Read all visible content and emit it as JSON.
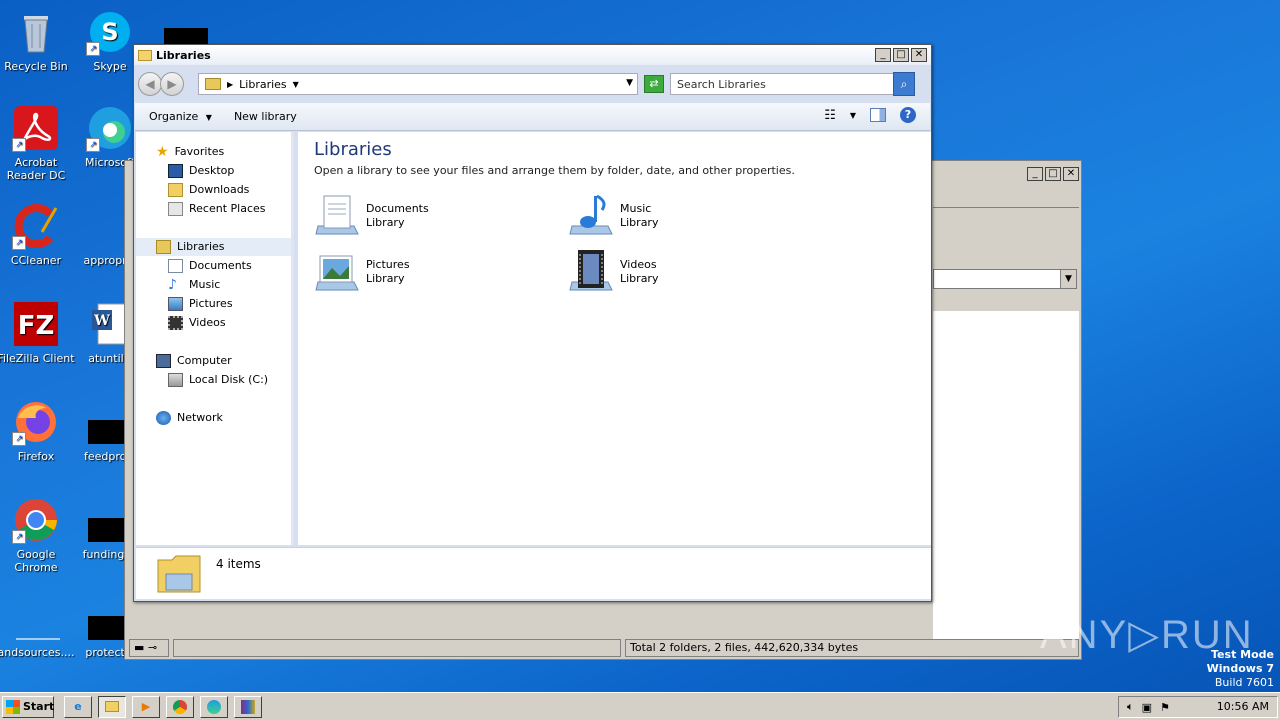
{
  "desktop": {
    "icons": [
      {
        "label": "Recycle Bin"
      },
      {
        "label": "Skype"
      },
      {
        "label": "Acrobat Reader DC"
      },
      {
        "label": "Microsoft"
      },
      {
        "label": "CCleaner"
      },
      {
        "label": "appropria"
      },
      {
        "label": "FileZilla Client"
      },
      {
        "label": "atuntil.r"
      },
      {
        "label": "Firefox"
      },
      {
        "label": "feedprovi"
      },
      {
        "label": "Google Chrome"
      },
      {
        "label": "fundingch"
      },
      {
        "label": "andsources...."
      },
      {
        "label": "protectio"
      }
    ]
  },
  "back_window": {
    "status_text": "Total 2 folders, 2 files, 442,620,334 bytes"
  },
  "explorer": {
    "title": "Libraries",
    "address": {
      "crumb": "Libraries"
    },
    "search": {
      "placeholder": "Search Libraries"
    },
    "toolbar": {
      "organize": "Organize",
      "new_library": "New library"
    },
    "nav": {
      "favorites": "Favorites",
      "desktop": "Desktop",
      "downloads": "Downloads",
      "recent": "Recent Places",
      "libraries": "Libraries",
      "documents": "Documents",
      "music": "Music",
      "pictures": "Pictures",
      "videos": "Videos",
      "computer": "Computer",
      "local_disk": "Local Disk (C:)",
      "network": "Network"
    },
    "content": {
      "heading": "Libraries",
      "description": "Open a library to see your files and arrange them by folder, date, and other properties.",
      "libraries": [
        {
          "name": "Documents",
          "type": "Library",
          "icon": "documents-library-icon"
        },
        {
          "name": "Music",
          "type": "Library",
          "icon": "music-library-icon"
        },
        {
          "name": "Pictures",
          "type": "Library",
          "icon": "pictures-library-icon"
        },
        {
          "name": "Videos",
          "type": "Library",
          "icon": "videos-library-icon"
        }
      ]
    },
    "details": {
      "count": "4 items"
    }
  },
  "taskbar": {
    "start": "Start",
    "clock": "10:56 AM"
  },
  "watermark": {
    "line1": "Test Mode",
    "line2": "Windows 7",
    "line3": "Build 7601",
    "brand": "ANY RUN"
  }
}
